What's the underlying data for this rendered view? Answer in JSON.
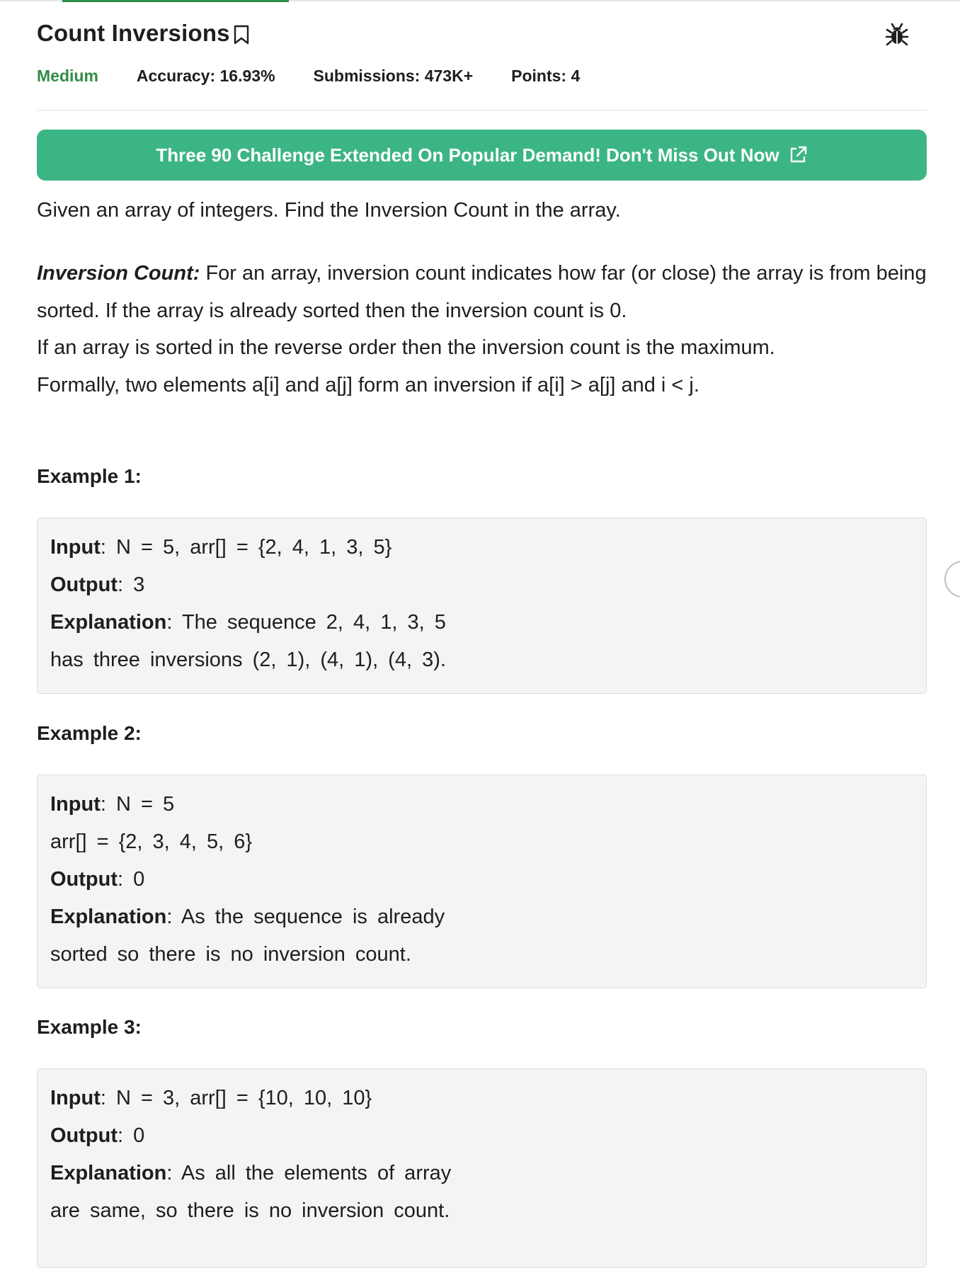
{
  "problem": {
    "title": "Count Inversions",
    "difficulty": "Medium",
    "accuracy": "Accuracy: 16.93%",
    "submissions": "Submissions: 473K+",
    "points": "Points: 4"
  },
  "banner": {
    "text": "Three 90 Challenge Extended On Popular Demand! Don't Miss Out Now"
  },
  "description": {
    "intro": "Given an array of integers. Find the Inversion Count in the array.",
    "term": "Inversion Count:",
    "definition": "For an array, inversion count indicates how far (or close) the array is from being sorted. If the array is already sorted then the inversion count is 0.",
    "reverse_note": "If an array is sorted in the reverse order then the inversion count is the maximum.",
    "formal": "Formally, two elements a[i] and a[j] form an inversion if a[i] > a[j] and i < j."
  },
  "examples": [
    {
      "heading": "Example 1:",
      "lines": [
        {
          "label": "Input",
          "text": ": N = 5, arr[] = {2, 4, 1, 3, 5}"
        },
        {
          "label": "Output",
          "text": ": 3"
        },
        {
          "label": "Explanation",
          "text": ": The sequence 2, 4, 1, 3, 5"
        },
        {
          "label": "",
          "text": "has three inversions (2, 1), (4, 1), (4, 3)."
        }
      ]
    },
    {
      "heading": "Example 2:",
      "lines": [
        {
          "label": "Input",
          "text": ": N = 5"
        },
        {
          "label": "",
          "text": "arr[] = {2, 3, 4, 5, 6}"
        },
        {
          "label": "Output",
          "text": ": 0"
        },
        {
          "label": "Explanation",
          "text": ": As the sequence is already"
        },
        {
          "label": "",
          "text": "sorted so there is no inversion count."
        }
      ]
    },
    {
      "heading": "Example 3:",
      "lines": [
        {
          "label": "Input",
          "text": ": N = 3, arr[] = {10, 10, 10}"
        },
        {
          "label": "Output",
          "text": ": 0"
        },
        {
          "label": "Explanation",
          "text": ": As all the elements of array"
        },
        {
          "label": "",
          "text": "are same, so there is no inversion count."
        }
      ]
    }
  ],
  "icons": {
    "bookmark": "bookmark-icon",
    "bug": "bug-icon",
    "external_link": "external-link-icon"
  },
  "colors": {
    "accent_green": "#2f8d46",
    "banner_green": "#3cb584",
    "example_bg": "#f4f4f4"
  }
}
